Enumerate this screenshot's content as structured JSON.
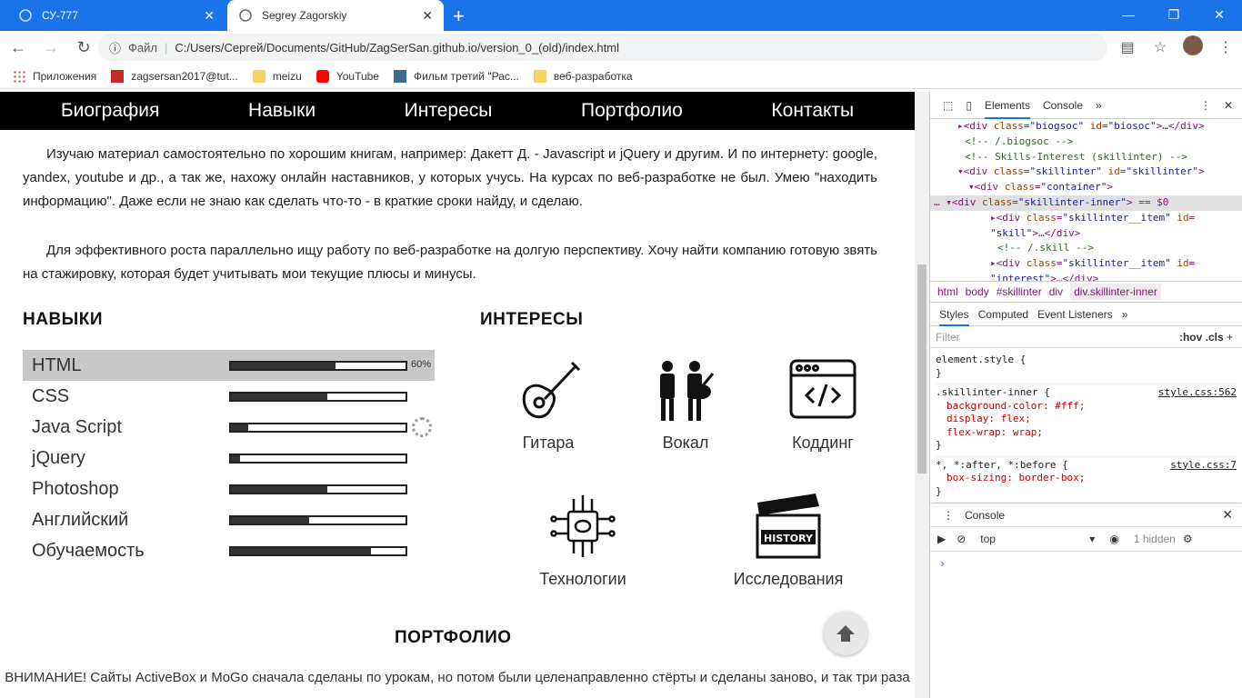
{
  "browser": {
    "tabs": [
      {
        "title": "СУ-777",
        "active": false
      },
      {
        "title": "Segrey Zagorskiy",
        "active": true
      }
    ],
    "address": {
      "scheme_label": "Файл",
      "url": "C:/Users/Сергей/Documents/GitHub/ZagSerSan.github.io/version_0_(old)/index.html"
    },
    "bookmarks": [
      {
        "label": "Приложения",
        "icon": "apps-icon"
      },
      {
        "label": "zagsersan2017@tut...",
        "icon": "mail-icon"
      },
      {
        "label": "meizu",
        "icon": "folder-icon"
      },
      {
        "label": "YouTube",
        "icon": "youtube-icon"
      },
      {
        "label": "Фильм третий \"Рас...",
        "icon": "film-icon"
      },
      {
        "label": "веб-разработка",
        "icon": "folder-icon"
      }
    ]
  },
  "site": {
    "nav": [
      "Биография",
      "Навыки",
      "Интересы",
      "Портфолио",
      "Контакты"
    ],
    "para1": "Изучаю материал самостоятельно по хорошим книгам, например: Дакетт Д. - Javascript и jQuery и другим. И по интернету: google, yandex, youtube и др., а так же, нахожу онлайн наставников, у которых учусь. На курсах по веб-разработке не был. Умею \"находить информацию\". Даже если не знаю как сделать что-то - в краткие сроки найду, и сделаю.",
    "para2": "Для эффективного роста параллельно ищу работу по веб-разработке на долгую перспективу. Хочу найти компанию готовую звять на стажировку, которая будет учитывать мои текущие плюсы и минусы.",
    "skills_title": "НАВЫКИ",
    "interests_title": "ИНТЕРЕСЫ",
    "skills": [
      {
        "name": "HTML",
        "level": 0.6,
        "label": "60%"
      },
      {
        "name": "CSS",
        "level": 0.55
      },
      {
        "name": "Java Script",
        "level": 0.1
      },
      {
        "name": "jQuery",
        "level": 0.05
      },
      {
        "name": "Photoshop",
        "level": 0.55
      },
      {
        "name": "Английский",
        "level": 0.45
      },
      {
        "name": "Обучаемость",
        "level": 0.8
      }
    ],
    "interests": [
      {
        "label": "Гитара",
        "icon": "guitar-icon"
      },
      {
        "label": "Вокал",
        "icon": "vocal-icon"
      },
      {
        "label": "Коддинг",
        "icon": "code-window-icon"
      },
      {
        "label": "Технологии",
        "icon": "chip-brain-icon"
      },
      {
        "label": "Исследования",
        "icon": "history-clapper-icon"
      }
    ],
    "portfolio_title": "ПОРТФОЛИО",
    "notice": "ВНИМАНИЕ! Сайты ActiveBox и MoGo сначала сделаны по урокам, но потом были целенаправленно стёрты и сделаны заново, и так три раза"
  },
  "devtools": {
    "tabs": [
      "Elements",
      "Console"
    ],
    "breadcrumbs": [
      "html",
      "body",
      "#skillinter",
      "div",
      "div.skillinter-inner"
    ],
    "subtabs": [
      "Styles",
      "Computed",
      "Event Listeners"
    ],
    "filter_placeholder": "Filter",
    "filter_hov": ":hov",
    "filter_cls": ".cls",
    "console_title": "Console",
    "console_context": "top",
    "hidden_count": "1 hidden",
    "rules": [
      {
        "selector": "element.style {",
        "props": [],
        "src": ""
      },
      {
        "selector": ".skillinter-inner {",
        "props": [
          "background-color: #fff;",
          "display: flex;",
          "flex-wrap: wrap;"
        ],
        "src": "style.css:562"
      },
      {
        "selector": "*, *:after, *:before {",
        "props": [
          "box-sizing: border-box;"
        ],
        "src": "style.css:7"
      }
    ]
  }
}
